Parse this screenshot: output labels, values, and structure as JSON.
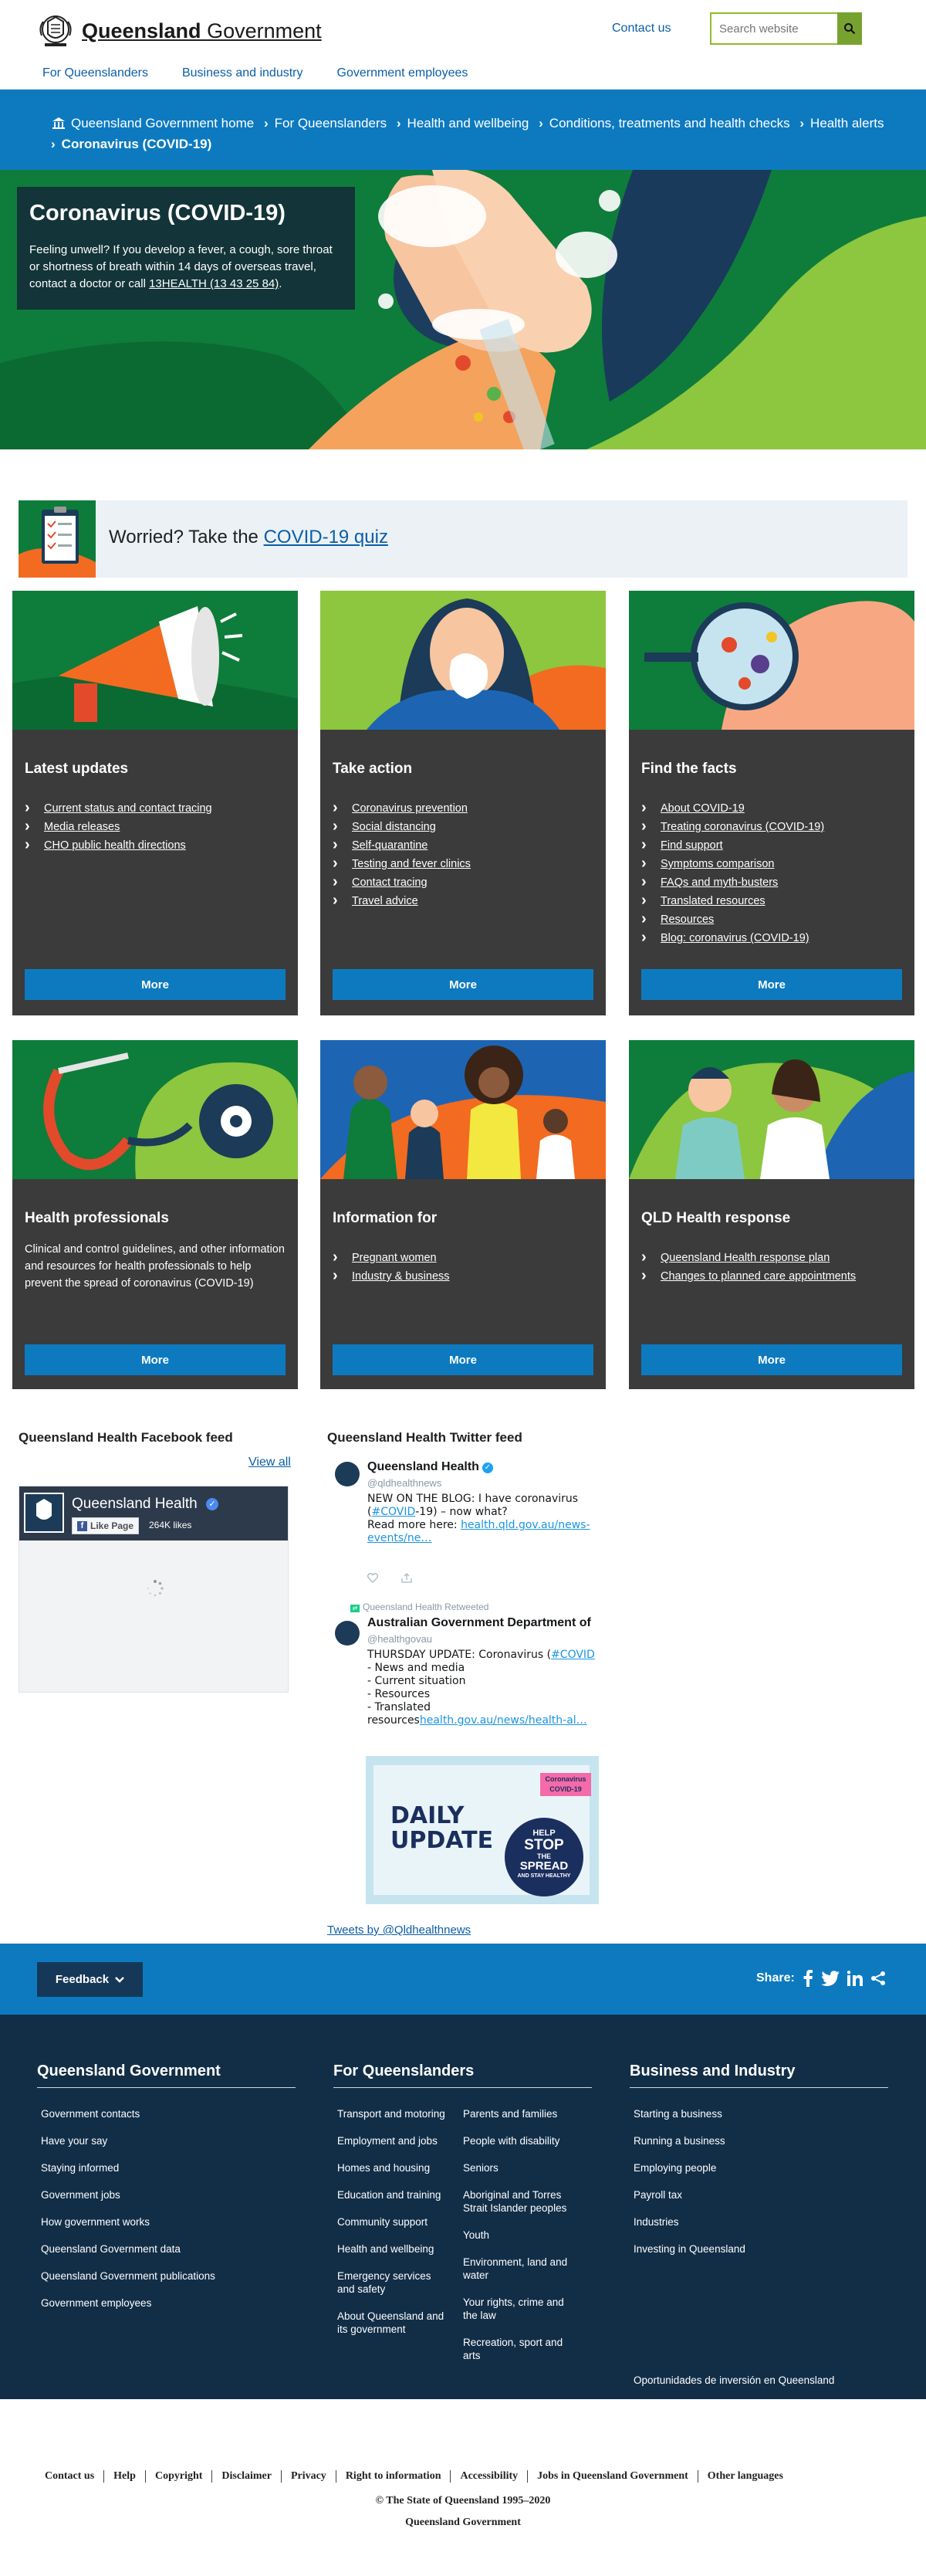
{
  "header": {
    "logo_strong": "Queensland",
    "logo_rest": "Government",
    "contact": "Contact us",
    "search_placeholder": "Search website",
    "nav": [
      "For Queenslanders",
      "Business and industry",
      "Government employees"
    ]
  },
  "breadcrumb": {
    "items": [
      "Queensland Government home",
      "For Queenslanders",
      "Health and wellbeing",
      "Conditions, treatments and health checks",
      "Health alerts"
    ],
    "current": "Coronavirus (COVID-19)"
  },
  "hero": {
    "title": "Coronavirus (COVID-19)",
    "text": "Feeling unwell? If you develop a fever, a cough, sore throat or shortness of breath within 14 days of overseas travel, contact a doctor or call",
    "phone": "13HEALTH (13 43 25 84)",
    "end": "."
  },
  "quiz": {
    "text": "Worried? Take the",
    "link": "COVID-19 quiz"
  },
  "cards": {
    "latest": {
      "title": "Latest updates",
      "links": [
        "Current status and contact tracing",
        "Media releases",
        "CHO public health directions"
      ],
      "more": "More"
    },
    "action": {
      "title": "Take action",
      "links": [
        "Coronavirus prevention",
        "Social distancing",
        "Self-quarantine",
        "Testing and fever clinics",
        "Contact tracing",
        "Travel advice"
      ],
      "more": "More"
    },
    "facts": {
      "title": "Find the facts",
      "links": [
        "About COVID-19",
        "Treating coronavirus (COVID-19)",
        "Find support",
        "Symptoms comparison",
        "FAQs and myth-busters",
        "Translated resources",
        "Resources",
        "Blog: coronavirus (COVID-19)"
      ],
      "more": "More"
    },
    "professionals": {
      "title": "Health professionals",
      "desc": "Clinical and control guidelines, and other information and resources for health professionals to help prevent the spread of coronavirus (COVID-19)",
      "more": "More"
    },
    "infofor": {
      "title": "Information for",
      "links": [
        "Pregnant women",
        "Industry & business"
      ],
      "more": "More"
    },
    "response": {
      "title": "QLD Health response",
      "links": [
        "Queensland Health response plan",
        "Changes to planned care appointments"
      ],
      "more": "More"
    }
  },
  "facebook": {
    "title": "Queensland Health Facebook feed",
    "view_all": "View all",
    "page_name": "Queensland Health",
    "like_button": "Like Page",
    "likes": "264K likes"
  },
  "twitter": {
    "title": "Queensland Health Twitter feed",
    "tweet1": {
      "name": "Queensland Health",
      "handle": "@qldhealthnews",
      "line1": "NEW ON THE BLOG: I have coronavirus",
      "line2_pre": "(",
      "hashtag": "#COVID",
      "line2_post": "-19) – now what?",
      "line3_pre": "Read more here: ",
      "link_a": "health.qld.gov.au/news-",
      "link_b": "events/ne…"
    },
    "retweet_label": "Queensland Health Retweeted",
    "tweet2": {
      "name": "Australian Government Department of",
      "handle": "@healthgovau",
      "line1_pre": "THURSDAY UPDATE: Coronavirus (",
      "hashtag": "#COVID",
      "l2": "- News and media",
      "l3": "- Current situation",
      "l4": "- Resources",
      "l5": "- Translated",
      "l6_pre": "resources",
      "l6_link": "health.gov.au/news/health-al…"
    },
    "image": {
      "title_line1": "DAILY",
      "title_line2": "UPDATE",
      "badge_line1": "Coronavirus",
      "badge_line2": "COVID-19",
      "bubble_line1": "HELP",
      "bubble_line2": "STOP",
      "bubble_line3": "THE",
      "bubble_line4": "SPREAD",
      "bubble_line5": "AND STAY HEALTHY"
    },
    "tweets_by": "Tweets by @Qldhealthnews"
  },
  "feedback": {
    "button": "Feedback",
    "share": "Share:"
  },
  "footer": {
    "col1": {
      "title": "Queensland Government",
      "links": [
        "Government contacts",
        "Have your say",
        "Staying informed",
        "Government jobs",
        "How government works",
        "Queensland Government data",
        "Queensland Government publications",
        "Government employees"
      ]
    },
    "col2": {
      "title": "For Queenslanders",
      "links_a": [
        "Transport and motoring",
        "Employment and jobs",
        "Homes and housing",
        "Education and training",
        "Community support",
        "Health and wellbeing",
        "Emergency services and safety",
        "About Queensland and its government"
      ],
      "links_b": [
        "Parents and families",
        "People with disability",
        "Seniors",
        "Aboriginal and Torres Strait Islander peoples",
        "Youth",
        "Environment, land and water",
        "Your rights, crime and the law",
        "Recreation, sport and arts"
      ]
    },
    "col3": {
      "title": "Business and Industry",
      "links": [
        "Starting a business",
        "Running a business",
        "Employing people",
        "Payroll tax",
        "Industries",
        "Investing in Queensland"
      ],
      "extra": "Oportunidades de inversión en Queensland"
    }
  },
  "bottom": {
    "links": [
      "Contact us",
      "Help",
      "Copyright",
      "Disclaimer",
      "Privacy",
      "Right to information",
      "Accessibility",
      "Jobs in Queensland Government",
      "Other languages"
    ],
    "copyright": "© The State of Queensland 1995–2020",
    "owner": "Queensland Government"
  },
  "colors": {
    "brand_blue": "#0d7ac0",
    "dark_navy": "#122e47",
    "card_grey": "#3b3b3b",
    "green": "#0e7c3a",
    "search_green": "#78a22f"
  }
}
